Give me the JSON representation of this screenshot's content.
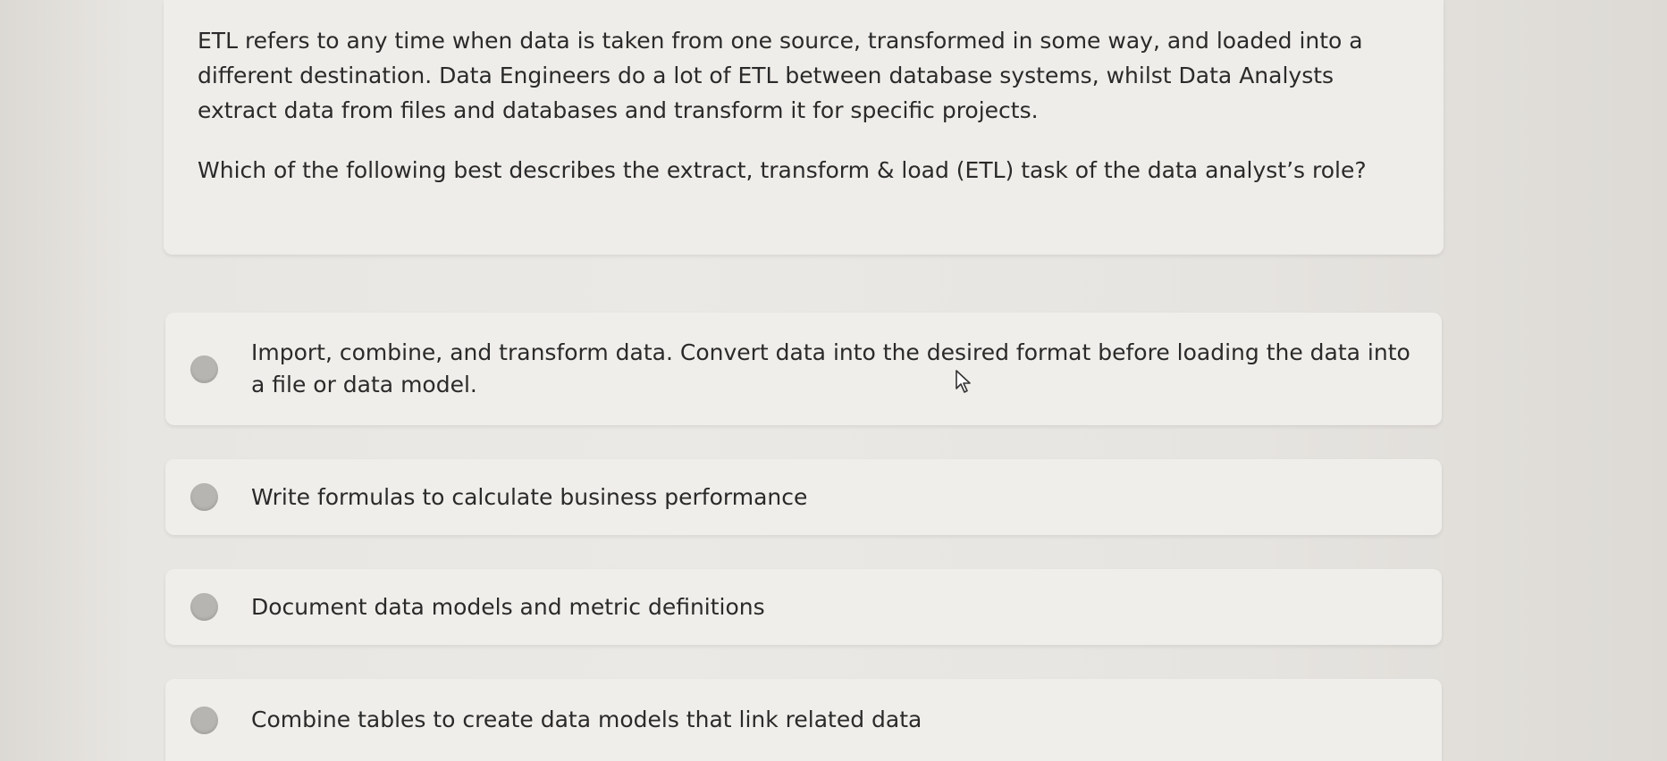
{
  "question": {
    "intro": "ETL refers to any time when data is taken from one source, transformed in some way, and loaded into a different destination. Data Engineers do a lot of ETL between database systems, whilst Data Analysts extract data from files and databases and transform it for specific projects.",
    "prompt": "Which of the following best describes the extract, transform & load (ETL) task of the data analyst’s role?"
  },
  "options": [
    {
      "label": "Import, combine, and transform data. Convert data into the desired format before loading the data into a file or data model."
    },
    {
      "label": "Write formulas to calculate business performance"
    },
    {
      "label": "Document data models and metric definitions"
    },
    {
      "label": "Combine tables to create data models that link related data"
    }
  ],
  "icons": {
    "radio": "radio-button-unselected",
    "cursor": "mouse-pointer-arrow"
  },
  "colors": {
    "card_background": "#efede9",
    "radio_unselected": "#b6b5b2",
    "text": "#2a2a2a"
  }
}
